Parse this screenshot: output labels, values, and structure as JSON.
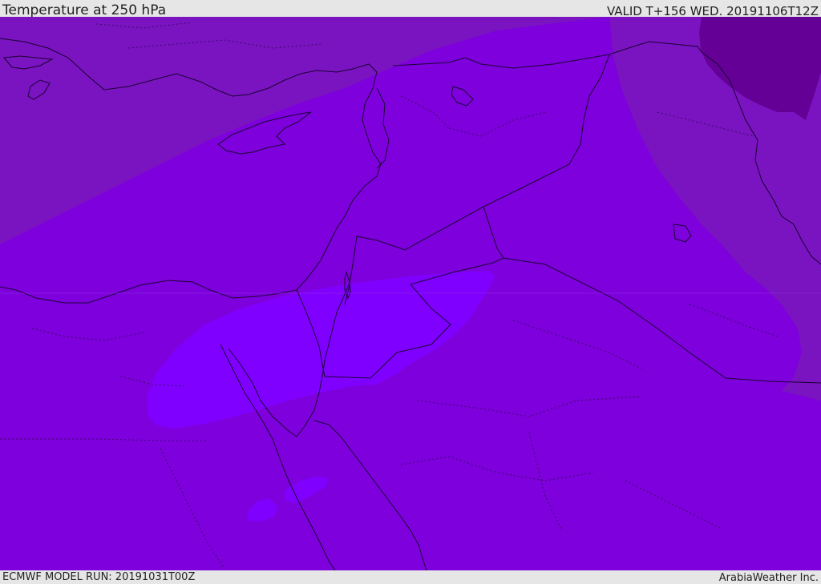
{
  "header": {
    "title": "Temperature at 250 hPa",
    "valid_time": "VALID T+156 WED. 20191106T12Z"
  },
  "footer": {
    "model_run": "ECMWF MODEL RUN: 20191031T00Z",
    "credit": "ArabiaWeather Inc."
  },
  "map": {
    "field": "Temperature at 250 hPa",
    "colors": {
      "base_fill": "#7e00dc",
      "cooler_band": "#7a14c0",
      "coldest_patch": "#640096",
      "warm_patch": "#8000ff",
      "border_line": "#1a0033",
      "admin_line": "#3a0a66"
    }
  }
}
